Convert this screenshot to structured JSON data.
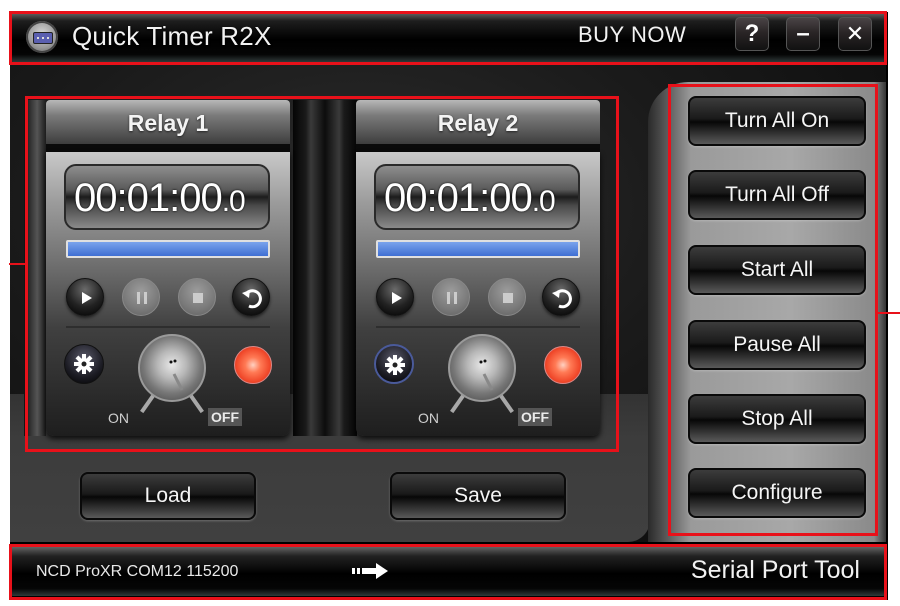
{
  "window": {
    "title": "Quick Timer R2X",
    "buy_now": "BUY NOW",
    "help_label": "?",
    "minimize_label": "–",
    "close_label": "✕"
  },
  "relays": [
    {
      "name": "Relay 1",
      "timer": "00:01:00",
      "timer_tenths": ".0",
      "progress": 1.0,
      "switch_on_label": "ON",
      "switch_off_label": "OFF",
      "switch_state": "OFF",
      "led_color": "#f0482a",
      "controls": {
        "play": "enabled",
        "pause": "disabled",
        "stop": "disabled",
        "reset": "enabled"
      }
    },
    {
      "name": "Relay 2",
      "timer": "00:01:00",
      "timer_tenths": ".0",
      "progress": 1.0,
      "switch_on_label": "ON",
      "switch_off_label": "OFF",
      "switch_state": "OFF",
      "led_color": "#f0482a",
      "controls": {
        "play": "enabled",
        "pause": "disabled",
        "stop": "disabled",
        "reset": "enabled"
      }
    }
  ],
  "actions": {
    "load": "Load",
    "save": "Save"
  },
  "side_buttons": [
    {
      "label": "Turn All On"
    },
    {
      "label": "Turn All Off"
    },
    {
      "label": "Start All"
    },
    {
      "label": "Pause All"
    },
    {
      "label": "Stop All"
    },
    {
      "label": "Configure"
    }
  ],
  "status_bar": {
    "connection": "NCD ProXR COM12 115200",
    "tool_name": "Serial Port Tool"
  },
  "colors": {
    "accent_progress": "#4f7fe0",
    "annotation": "#e8111a"
  }
}
